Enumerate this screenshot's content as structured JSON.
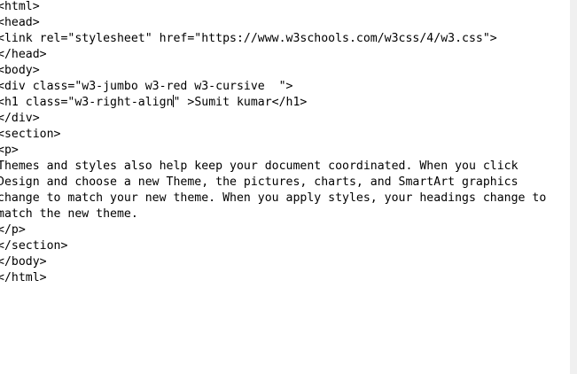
{
  "editor": {
    "lines": [
      "<html>",
      "<head>",
      "<link rel=\"stylesheet\" href=\"https://www.w3schools.com/w3css/4/w3.css\">",
      "</head>",
      "<body>",
      "<div class=\"w3-jumbo w3-red w3-cursive  \">",
      {
        "before_caret": "<h1 class=\"w3-right-align",
        "after_caret": "\" >Sumit kumar</h1>"
      },
      "</div>",
      "<section>",
      "<p>",
      "Themes and styles also help keep your document coordinated. When you click",
      "Design and choose a new Theme, the pictures, charts, and SmartArt graphics",
      "change to match your new theme. When you apply styles, your headings change to",
      "match the new theme.",
      "</p>",
      "</section>",
      "</body>",
      "</html>"
    ]
  }
}
